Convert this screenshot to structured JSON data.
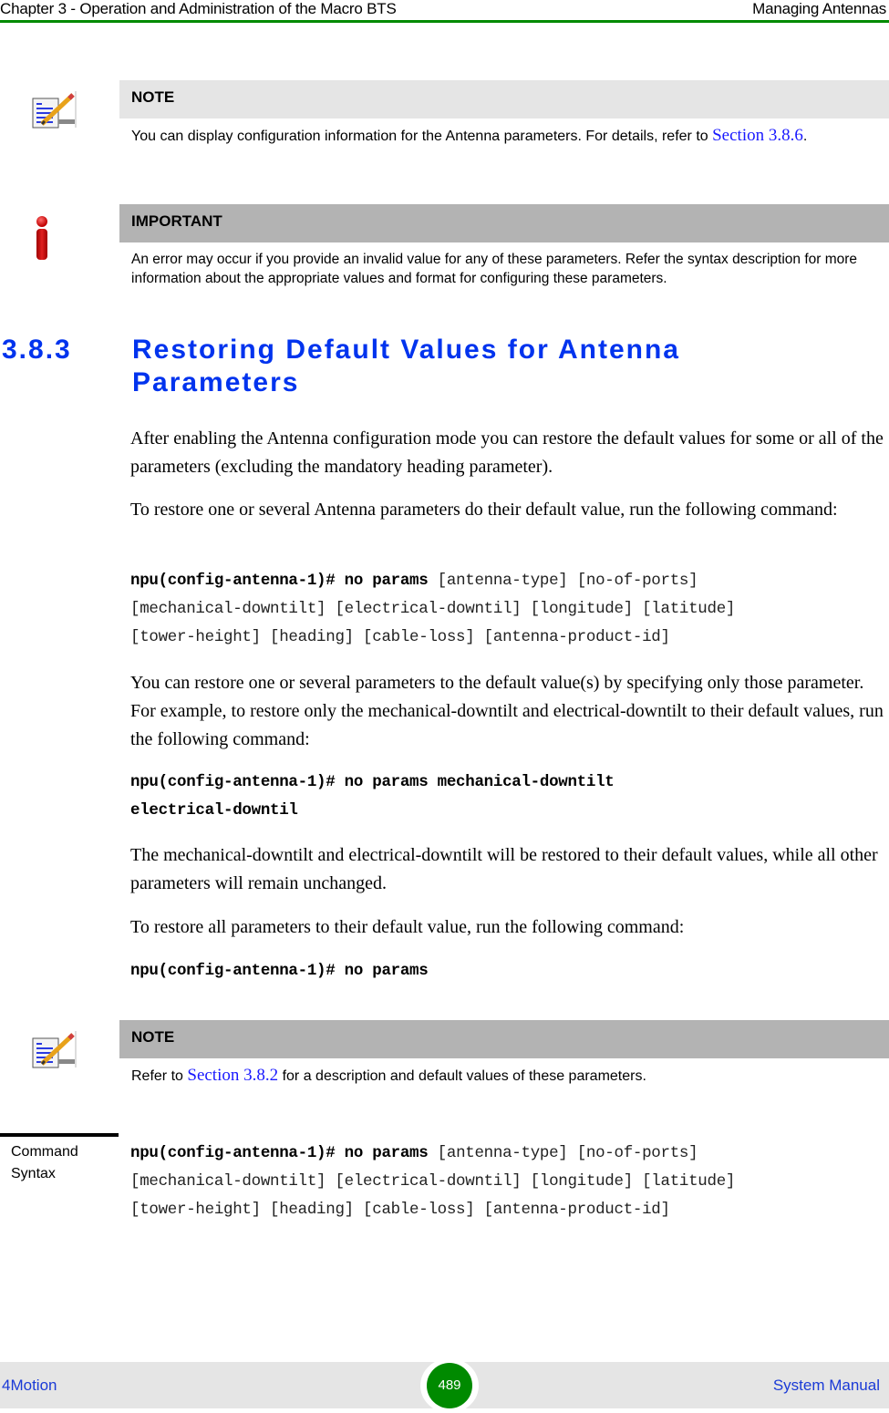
{
  "header": {
    "chapter": "Chapter 3 - Operation and Administration of the Macro BTS",
    "section": "Managing Antennas",
    "accent_color": "#008a00"
  },
  "note1": {
    "icon": "note-pencil-icon",
    "title": "NOTE",
    "text_before": "You can display configuration information for the Antenna parameters. For details, refer to",
    "link": "Section 3.8.6",
    "text_after": "."
  },
  "important": {
    "icon": "important-info-icon",
    "title": "IMPORTANT",
    "text": "An error may occur if you provide an invalid value for any of these parameters. Refer the syntax description for more information about the appropriate values and format for configuring these parameters."
  },
  "section": {
    "number": "3.8.3",
    "title": "Restoring Default Values for Antenna Parameters",
    "color": "#0033ee"
  },
  "paragraphs": {
    "p1": "After enabling the Antenna configuration mode you can restore the default values for some or all of the parameters (excluding the mandatory heading parameter).",
    "p2": "To restore one or several Antenna parameters do their default value, run the following command:",
    "p3": "You can restore one or several parameters to the default value(s) by specifying only those parameter. For example, to restore only the mechanical-downtilt and electrical-downtilt to their default values, run the following command:",
    "p4": "The mechanical-downtilt and electrical-downtilt will be restored to their default values, while all other parameters will remain unchanged.",
    "p5": "To restore all parameters to their default value, run the following command:"
  },
  "commands": {
    "cmd1_prefix": "npu(config-antenna-1)# no params",
    "cmd1_args_line1": "[antenna-type] [no-of-ports]",
    "cmd1_args_line2": "[mechanical-downtilt] [electrical-downtil] [longitude] [latitude]",
    "cmd1_args_line3": "[tower-height] [heading] [cable-loss] [antenna-product-id]",
    "cmd2_line1": "npu(config-antenna-1)# no params mechanical-downtilt",
    "cmd2_line2": "electrical-downtil",
    "cmd3": "npu(config-antenna-1)# no params"
  },
  "note2": {
    "icon": "note-pencil-icon",
    "title": "NOTE",
    "text_before": "Refer to",
    "link": "Section 3.8.2",
    "text_after": "for a description and default values of these parameters."
  },
  "syntax": {
    "label_line1": "Command",
    "label_line2": "Syntax",
    "prefix": "npu(config-antenna-1)# no params",
    "args_line1": "[antenna-type] [no-of-ports]",
    "args_line2": "[mechanical-downtilt] [electrical-downtil] [longitude] [latitude]",
    "args_line3": "[tower-height] [heading] [cable-loss] [antenna-product-id]"
  },
  "footer": {
    "product": "4Motion",
    "page_number": "489",
    "manual": "System Manual"
  }
}
